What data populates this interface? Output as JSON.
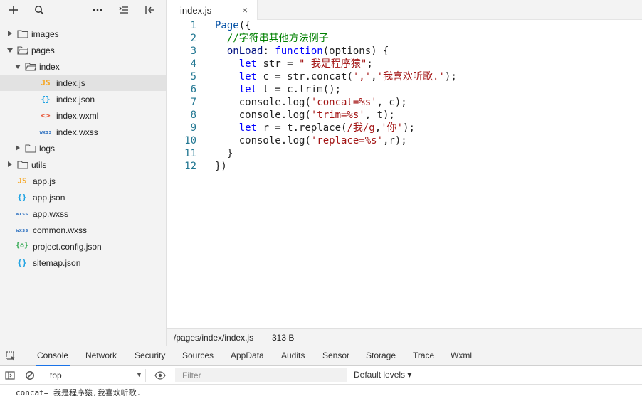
{
  "sidebar": {
    "toolbar_icons": [
      "plus-icon",
      "search-icon",
      "more-icon",
      "collapse-all-icon",
      "split-icon"
    ],
    "tree": [
      {
        "label": "images",
        "type": "folder",
        "expanded": false,
        "depth": 0
      },
      {
        "label": "pages",
        "type": "folder",
        "expanded": true,
        "depth": 0
      },
      {
        "label": "index",
        "type": "folder",
        "expanded": true,
        "depth": 1
      },
      {
        "label": "index.js",
        "type": "js",
        "icon_text": "JS",
        "depth": 2,
        "selected": true
      },
      {
        "label": "index.json",
        "type": "json",
        "icon_text": "{}",
        "depth": 2
      },
      {
        "label": "index.wxml",
        "type": "wxml",
        "icon_text": "<>",
        "depth": 2
      },
      {
        "label": "index.wxss",
        "type": "wxss",
        "icon_text": "wxss",
        "depth": 2
      },
      {
        "label": "logs",
        "type": "folder",
        "expanded": false,
        "depth": 1
      },
      {
        "label": "utils",
        "type": "folder",
        "expanded": false,
        "depth": 0
      },
      {
        "label": "app.js",
        "type": "js",
        "icon_text": "JS",
        "depth": 0
      },
      {
        "label": "app.json",
        "type": "json",
        "icon_text": "{}",
        "depth": 0
      },
      {
        "label": "app.wxss",
        "type": "wxss",
        "icon_text": "wxss",
        "depth": 0
      },
      {
        "label": "common.wxss",
        "type": "wxss",
        "icon_text": "wxss",
        "depth": 0
      },
      {
        "label": "project.config.json",
        "type": "config",
        "icon_text": "{o}",
        "depth": 0
      },
      {
        "label": "sitemap.json",
        "type": "json",
        "icon_text": "{}",
        "depth": 0
      }
    ]
  },
  "editor": {
    "tab_label": "index.js",
    "close_glyph": "×",
    "lines": [
      {
        "n": "1",
        "code": "Page({"
      },
      {
        "n": "2",
        "code": "  //字符串其他方法例子"
      },
      {
        "n": "3",
        "code": "  onLoad: function(options) {"
      },
      {
        "n": "4",
        "code": "    let str = \" 我是程序猿\";"
      },
      {
        "n": "5",
        "code": "    let c = str.concat(',','我喜欢听歌.');"
      },
      {
        "n": "6",
        "code": "    let t = c.trim();"
      },
      {
        "n": "7",
        "code": "    console.log('concat=%s', c);"
      },
      {
        "n": "8",
        "code": "    console.log('trim=%s', t);"
      },
      {
        "n": "9",
        "code": "    let r = t.replace(/我/g,'你');"
      },
      {
        "n": "10",
        "code": "    console.log('replace=%s',r);"
      },
      {
        "n": "11",
        "code": "  }"
      },
      {
        "n": "12",
        "code": "})"
      }
    ]
  },
  "statusbar": {
    "path": "/pages/index/index.js",
    "size": "313 B"
  },
  "devtools": {
    "tabs": [
      "Console",
      "Network",
      "Security",
      "Sources",
      "AppData",
      "Audits",
      "Sensor",
      "Storage",
      "Trace",
      "Wxml"
    ],
    "active_tab": "Console",
    "context": "top",
    "filter_placeholder": "Filter",
    "levels_label": "Default levels ▾",
    "console_output": "concat= 我是程序猿,我喜欢听歌."
  },
  "colors": {
    "js_icon": "#f5a623",
    "json_icon": "#1ba1e2",
    "wxml_icon": "#e8583a",
    "wxss_icon": "#2b6fbf",
    "config_icon": "#2fa84f",
    "line_number": "#237893",
    "active_tab_underline": "#1a73e8"
  }
}
